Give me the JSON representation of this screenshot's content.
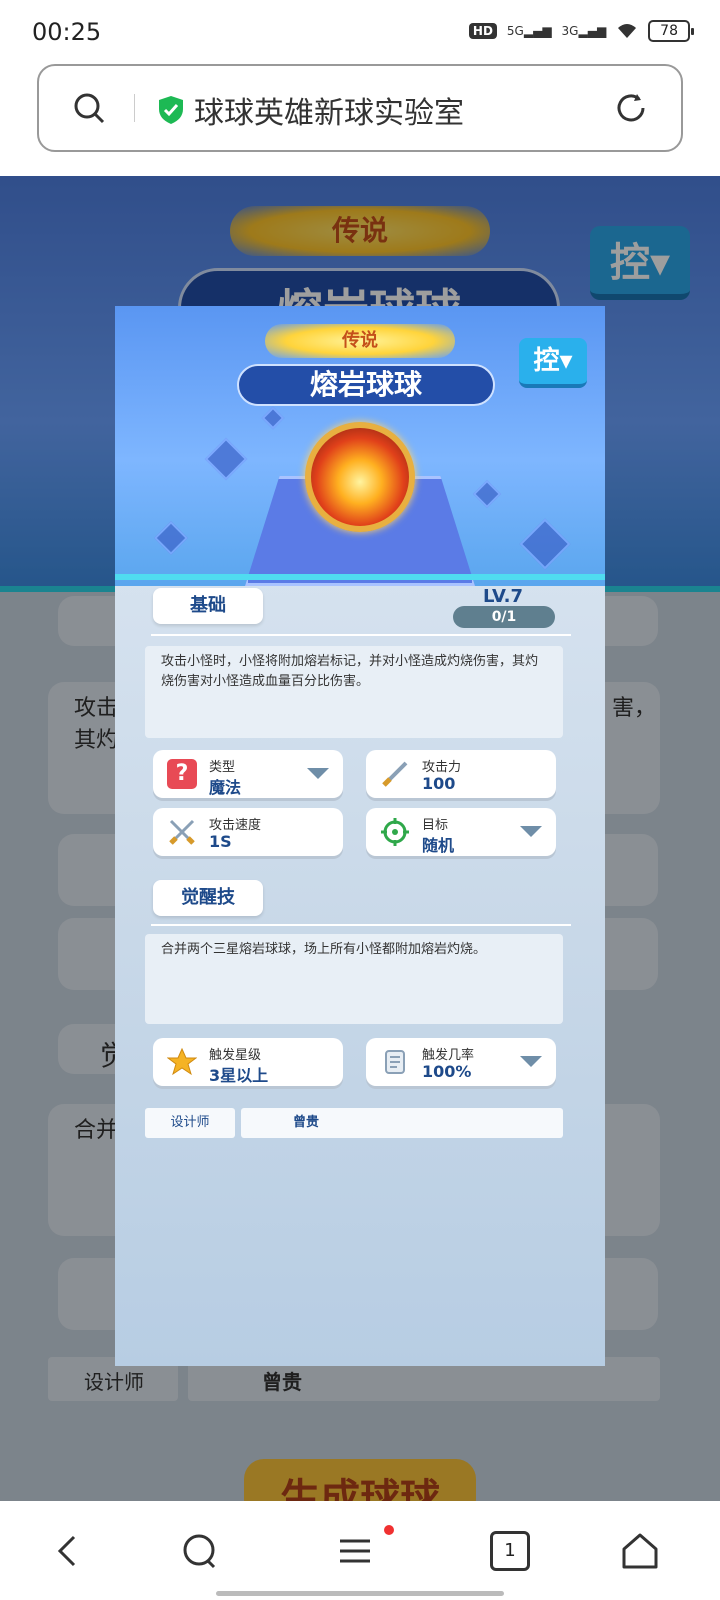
{
  "status_bar": {
    "time": "00:25",
    "hd": "HD",
    "net1": "5G",
    "net2": "3G",
    "battery": "78"
  },
  "address_bar": {
    "title": "球球英雄新球实验室"
  },
  "background_page": {
    "rarity": "传说",
    "ball_name": "熔岩球球",
    "control_label": "控",
    "desc_fragment_left": "攻击",
    "desc_fragment_left2": "其灼",
    "desc_fragment_right": "害，",
    "awaken_fragment": "觉",
    "desc2_fragment": "合并",
    "designer_label": "设计师",
    "designer_value": "曾贵",
    "generate_button": "生成球球"
  },
  "modal": {
    "rarity": "传说",
    "ball_name": "熔岩球球",
    "control_label": "控",
    "basic_tab": "基础",
    "level": "LV.7",
    "level_progress": "0/1",
    "description": "攻击小怪时，小怪将附加熔岩标记，并对小怪造成灼烧伤害，其灼烧伤害对小怪造成血量百分比伤害。",
    "stats": [
      {
        "label": "类型",
        "value": "魔法",
        "icon": "question-icon",
        "dropdown": true
      },
      {
        "label": "攻击力",
        "value": "100",
        "icon": "sword-icon",
        "dropdown": false
      },
      {
        "label": "攻击速度",
        "value": "1S",
        "icon": "crossed-swords-icon",
        "dropdown": false
      },
      {
        "label": "目标",
        "value": "随机",
        "icon": "target-icon",
        "dropdown": true
      }
    ],
    "awaken_tab": "觉醒技",
    "awaken_description": "合并两个三星熔岩球球，场上所有小怪都附加熔岩灼烧。",
    "trigger": [
      {
        "label": "触发星级",
        "value": "3星以上",
        "icon": "star-icon",
        "dropdown": false
      },
      {
        "label": "触发几率",
        "value": "100%",
        "icon": "scroll-icon",
        "dropdown": true
      }
    ],
    "designer_label": "设计师",
    "designer_value": "曾贵"
  },
  "nav": {
    "tabs_count": "1"
  },
  "colors": {
    "accent_blue": "#1e4a8a",
    "legend_gold": "#ffd43b",
    "control_blue": "#2ab0ec"
  }
}
